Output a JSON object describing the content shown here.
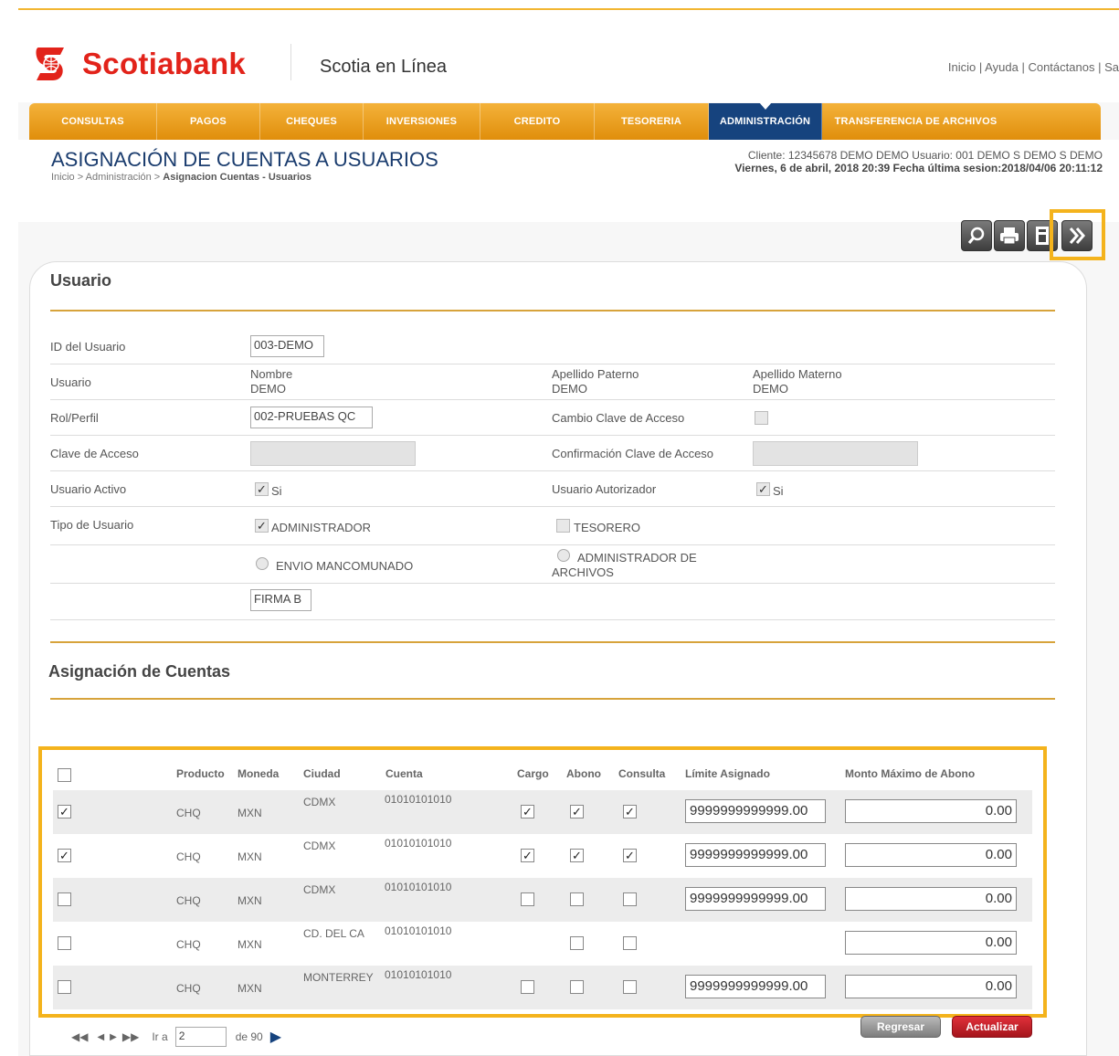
{
  "brand": {
    "logo_text": "Scotiabank",
    "app_name": "Scotia en Línea",
    "red": "#e2231a",
    "gold": "#f4b31c",
    "navy": "#16437e"
  },
  "top_links": {
    "inicio": "Inicio",
    "ayuda": "Ayuda",
    "contactanos": "Contáctanos",
    "salir": "Sa",
    "sep": "|"
  },
  "nav": {
    "items": [
      {
        "label": "CONSULTAS"
      },
      {
        "label": "PAGOS"
      },
      {
        "label": "CHEQUES"
      },
      {
        "label": "INVERSIONES"
      },
      {
        "label": "CREDITO"
      },
      {
        "label": "TESORERIA"
      },
      {
        "label": "ADMINISTRACIÓN"
      },
      {
        "label": "TRANSFERENCIA DE ARCHIVOS"
      }
    ]
  },
  "page": {
    "title": "ASIGNACIÓN DE CUENTAS A USUARIOS",
    "breadcrumb_start": "Inicio > Administración > ",
    "breadcrumb_current": "Asignacion Cuentas - Usuarios",
    "client_line": "Cliente: 12345678  DEMO DEMO    Usuario: 001 DEMO S DEMO S DEMO",
    "date_line": "Viernes, 6 de abril, 2018 20:39    Fecha última sesion:2018/04/06 20:11:12"
  },
  "toolbar": {
    "icons": [
      "search-icon",
      "print-icon",
      "export-icon",
      "next-icon"
    ]
  },
  "usuario": {
    "section_title": "Usuario",
    "id_label": "ID del Usuario",
    "id_value": "003-DEMO",
    "usuario_label": "Usuario",
    "nombre_label": "Nombre",
    "nombre_value": "DEMO",
    "ap_paterno_label": "Apellido Paterno",
    "ap_paterno_value": "DEMO",
    "ap_materno_label": "Apellido Materno",
    "ap_materno_value": "DEMO",
    "rol_label": "Rol/Perfil",
    "rol_value": "002-PRUEBAS QC",
    "cambio_clave_label": "Cambio Clave de Acceso",
    "clave_label": "Clave de Acceso",
    "conf_clave_label": "Confirmación Clave de Acceso",
    "activo_label": "Usuario Activo",
    "activo_value": "Si",
    "autorizador_label": "Usuario Autorizador",
    "autorizador_value": "Si",
    "tipo_label": "Tipo de Usuario",
    "tipo_admin": "ADMINISTRADOR",
    "tipo_tesorero": "TESORERO",
    "envio_mancomunado": "ENVIO MANCOMUNADO",
    "admin_archivos_1": "ADMINISTRADOR DE",
    "admin_archivos_2": "ARCHIVOS",
    "firma_value": "FIRMA B"
  },
  "cuentas": {
    "section_title": "Asignación de Cuentas",
    "headers": {
      "producto": "Producto",
      "moneda": "Moneda",
      "ciudad": "Ciudad",
      "cuenta": "Cuenta",
      "cargo": "Cargo",
      "abono": "Abono",
      "consulta": "Consulta",
      "limite": "Límite Asignado",
      "monto": "Monto Máximo de Abono"
    },
    "rows": [
      {
        "selected": true,
        "producto": "CHQ",
        "moneda": "MXN",
        "ciudad": "CDMX",
        "cuenta": "01010101010",
        "cargo": true,
        "abono": true,
        "consulta": true,
        "limite": "9999999999999.00",
        "monto": "0.00"
      },
      {
        "selected": true,
        "producto": "CHQ",
        "moneda": "MXN",
        "ciudad": "CDMX",
        "cuenta": "01010101010",
        "cargo": true,
        "abono": true,
        "consulta": true,
        "limite": "9999999999999.00",
        "monto": "0.00"
      },
      {
        "selected": false,
        "producto": "CHQ",
        "moneda": "MXN",
        "ciudad": "CDMX",
        "cuenta": "01010101010",
        "cargo": false,
        "abono": false,
        "consulta": false,
        "limite": "9999999999999.00",
        "monto": "0.00"
      },
      {
        "selected": false,
        "producto": "CHQ",
        "moneda": "MXN",
        "ciudad": "CD. DEL CA",
        "cuenta": "01010101010",
        "cargo": null,
        "abono": false,
        "consulta": false,
        "limite": null,
        "monto": "0.00"
      },
      {
        "selected": false,
        "producto": "CHQ",
        "moneda": "MXN",
        "ciudad": "MONTERREY",
        "cuenta": "01010101010",
        "cargo": false,
        "abono": false,
        "consulta": false,
        "limite": "9999999999999.00",
        "monto": "0.00"
      }
    ]
  },
  "pager": {
    "ir_a": "Ir a",
    "page": "2",
    "de_total": "de 90"
  },
  "actions": {
    "regresar": "Regresar",
    "actualizar": "Actualizar"
  }
}
